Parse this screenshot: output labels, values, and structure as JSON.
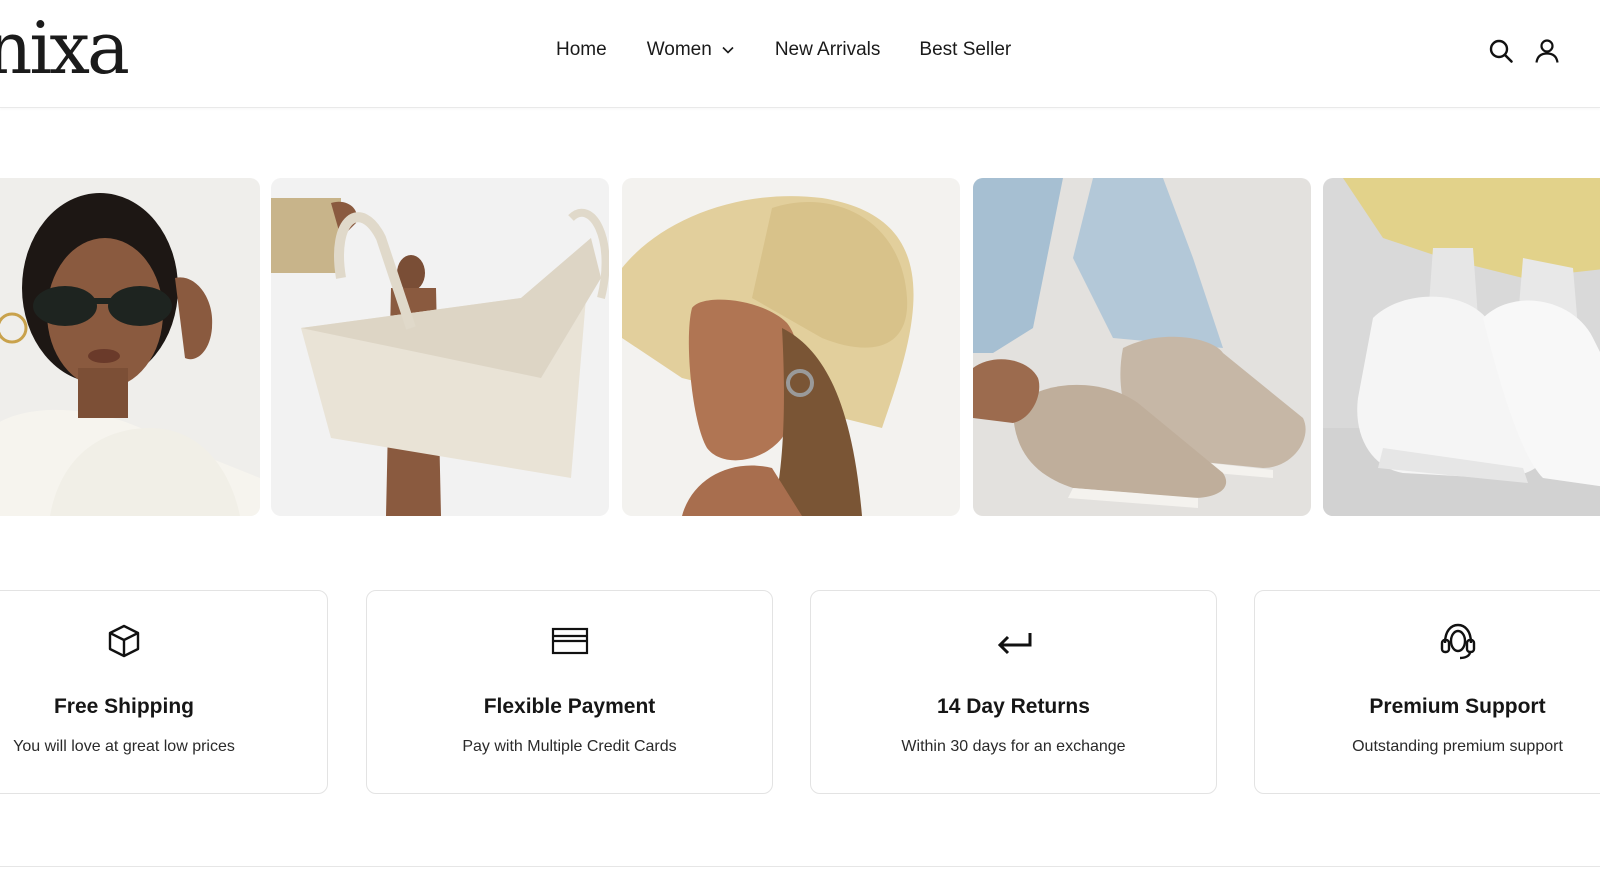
{
  "brand": {
    "logo_text": "nixa"
  },
  "nav": {
    "items": [
      {
        "label": "Home"
      },
      {
        "label": "Women",
        "has_dropdown": true
      },
      {
        "label": "New Arrivals"
      },
      {
        "label": "Best Seller"
      }
    ]
  },
  "header_icons": [
    "search-icon",
    "account-icon"
  ],
  "gallery": {
    "items": [
      {
        "name": "woman-sunglasses-photo"
      },
      {
        "name": "cream-tote-bag-photo"
      },
      {
        "name": "straw-hat-photo"
      },
      {
        "name": "suede-slip-on-shoes-photo"
      },
      {
        "name": "white-sneakers-photo"
      }
    ]
  },
  "features": [
    {
      "icon": "box-icon",
      "title": "Free Shipping",
      "desc": "You will love at great low prices"
    },
    {
      "icon": "credit-card-icon",
      "title": "Flexible Payment",
      "desc": "Pay with Multiple Credit Cards"
    },
    {
      "icon": "return-arrow-icon",
      "title": "14 Day Returns",
      "desc": "Within 30 days for an exchange"
    },
    {
      "icon": "headset-icon",
      "title": "Premium Support",
      "desc": "Outstanding premium support"
    }
  ],
  "colors": {
    "text": "#111111",
    "border": "#e3e3e3",
    "background": "#ffffff"
  }
}
